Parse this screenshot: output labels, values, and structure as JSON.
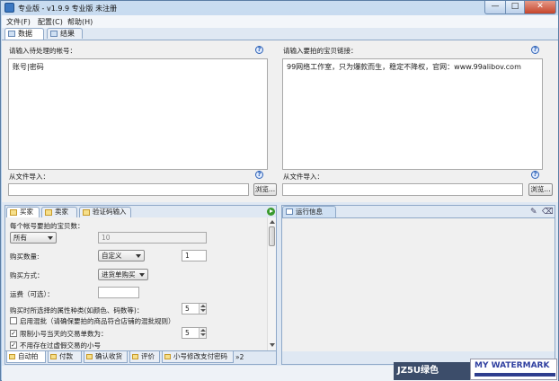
{
  "window": {
    "title": "专业版 - v1.9.9 专业版 未注册",
    "min": "—",
    "max": "□",
    "close": "✕"
  },
  "menu": [
    "文件(F)",
    "配置(C)",
    "帮助(H)"
  ],
  "main_tabs": [
    "数据",
    "结果"
  ],
  "accounts": {
    "label": "请输入待处理的帐号：",
    "value": "账号|密码",
    "import_label": "从文件导入：",
    "browse": "浏览..."
  },
  "links": {
    "label": "请输入要拍的宝贝链接：",
    "value": "99网络工作室，只为爆款而生，稳定不降权，官网：www.99alibov.com",
    "import_label": "从文件导入：",
    "browse": "浏览..."
  },
  "left_tabs": [
    "买家",
    "卖家",
    "验证码输入"
  ],
  "form": {
    "qty_label": "每个帐号要拍的宝贝数：",
    "qty_select": "所有",
    "qty_value": "10",
    "buy_qty_label": "购买数量:",
    "buy_qty_select": "自定义",
    "buy_qty_value": "1",
    "buy_method_label": "购买方式：",
    "buy_method_select": "进货单购买",
    "shipping_label": "运费（可选）：",
    "attr_label": "购买时所选择的属性种类(如颜色、码数等)：",
    "attr_value": "5",
    "check1": "启用混批（请确保要拍的商品符合店铺的混批规则）",
    "check1_checked": false,
    "check2": "限制小号当天的交易单数为：",
    "check2_checked": true,
    "check2_value": "5",
    "check3": "不用存在过虚假交易的小号",
    "check3_checked": true
  },
  "bottom_tabs": [
    "自动拍",
    "付款",
    "确认收货",
    "评价",
    "小号修改支付密码"
  ],
  "bottom_more": "»2",
  "right_tab": "运行信息",
  "watermark": {
    "left": "JZ5U绿色",
    "right": "MY WATERMARK"
  },
  "colors": {
    "accent": "#3b78c2",
    "play": "#3a9a2e"
  }
}
